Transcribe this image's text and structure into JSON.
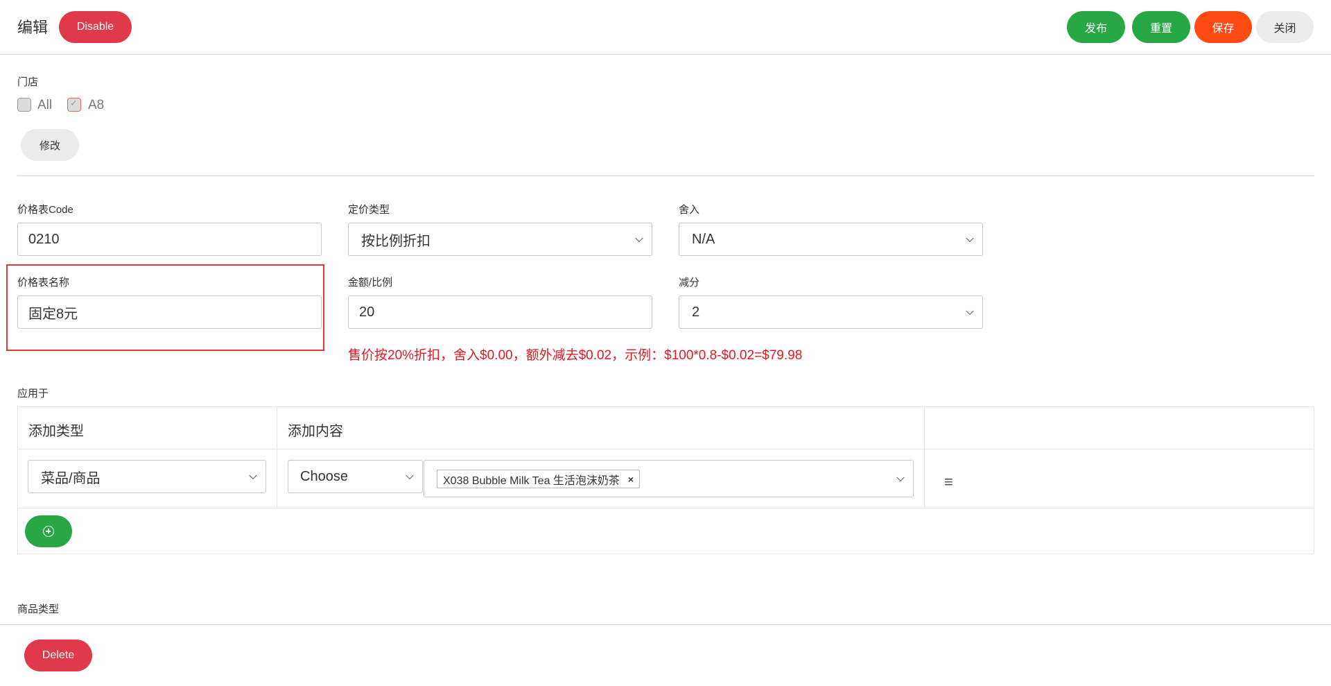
{
  "header": {
    "title": "编辑",
    "disable_label": "Disable",
    "publish_label": "发布",
    "reset_label": "重置",
    "save_label": "保存",
    "close_label": "关闭"
  },
  "stores": {
    "label": "门店",
    "options": [
      {
        "label": "All",
        "checked": false
      },
      {
        "label": "A8",
        "checked": true
      }
    ],
    "modify_label": "修改"
  },
  "form": {
    "code": {
      "label": "价格表Code",
      "value": "0210"
    },
    "pricing_type": {
      "label": "定价类型",
      "value": "按比例折扣"
    },
    "rounding": {
      "label": "舍入",
      "value": "N/A"
    },
    "name": {
      "label": "价格表名称",
      "value": "固定8元"
    },
    "amount": {
      "label": "金额/比例",
      "value": "20"
    },
    "deduct": {
      "label": "减分",
      "value": "2"
    },
    "hint": "售价按20%折扣，舍入$0.00，额外减去$0.02，示例：$100*0.8-$0.02=$79.98"
  },
  "apply": {
    "label": "应用于",
    "columns": [
      "添加类型",
      "添加内容"
    ],
    "rows": [
      {
        "type": "菜品/商品",
        "choose": "Choose",
        "tags": [
          "X038 Bubble Milk Tea 生活泡沫奶茶"
        ]
      }
    ]
  },
  "product_type": {
    "label": "商品类型"
  },
  "footer": {
    "delete_label": "Delete"
  },
  "colors": {
    "red": "#e0394a",
    "green": "#27a844",
    "orange": "#ff4a12",
    "gray": "#ececec",
    "hint_red": "#e8171d"
  }
}
